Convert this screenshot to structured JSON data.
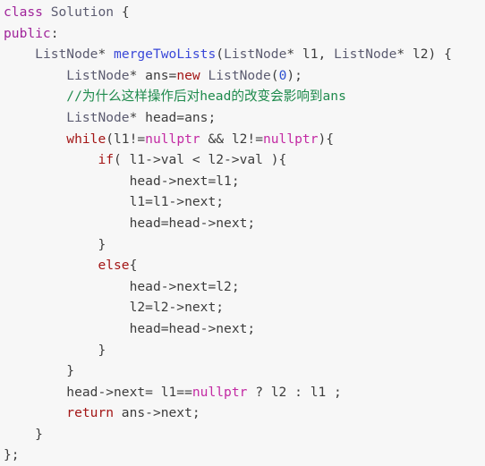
{
  "editor": {
    "language": "cpp",
    "background_color": "#f7f7f7",
    "default_text_color": "#3c3c3c",
    "palette": {
      "keyword_red": "#a31515",
      "keyword_purple": "#a0249a",
      "type_gray": "#5b5b70",
      "function_blue": "#3a48d8",
      "comment_green": "#1e8a4c",
      "number_blue": "#2c4fd0",
      "nullptr_magenta": "#c32aa3"
    }
  },
  "code": {
    "lines": [
      {
        "indent": 0,
        "tokens": [
          {
            "t": "class",
            "c": "kw2"
          },
          {
            "t": " ",
            "c": "plain"
          },
          {
            "t": "Solution",
            "c": "type"
          },
          {
            "t": " {",
            "c": "punct"
          }
        ]
      },
      {
        "indent": 0,
        "tokens": [
          {
            "t": "public",
            "c": "kw2"
          },
          {
            "t": ":",
            "c": "punct"
          }
        ]
      },
      {
        "indent": 1,
        "tokens": [
          {
            "t": "ListNode",
            "c": "type"
          },
          {
            "t": "* ",
            "c": "punct"
          },
          {
            "t": "mergeTwoLists",
            "c": "func"
          },
          {
            "t": "(",
            "c": "punct"
          },
          {
            "t": "ListNode",
            "c": "type"
          },
          {
            "t": "* l1, ",
            "c": "punct"
          },
          {
            "t": "ListNode",
            "c": "type"
          },
          {
            "t": "* l2) {",
            "c": "punct"
          }
        ]
      },
      {
        "indent": 2,
        "tokens": [
          {
            "t": "ListNode",
            "c": "type"
          },
          {
            "t": "* ans=",
            "c": "punct"
          },
          {
            "t": "new",
            "c": "keyword"
          },
          {
            "t": " ",
            "c": "plain"
          },
          {
            "t": "ListNode",
            "c": "type"
          },
          {
            "t": "(",
            "c": "punct"
          },
          {
            "t": "0",
            "c": "number"
          },
          {
            "t": ");",
            "c": "punct"
          }
        ]
      },
      {
        "indent": 2,
        "tokens": [
          {
            "t": "//为什么这样操作后对head的改变会影响到ans",
            "c": "comment"
          }
        ]
      },
      {
        "indent": 2,
        "tokens": [
          {
            "t": "ListNode",
            "c": "type"
          },
          {
            "t": "* head=ans;",
            "c": "punct"
          }
        ]
      },
      {
        "indent": 2,
        "tokens": [
          {
            "t": "while",
            "c": "keyword"
          },
          {
            "t": "(l1!=",
            "c": "punct"
          },
          {
            "t": "nullptr",
            "c": "null"
          },
          {
            "t": " && l2!=",
            "c": "punct"
          },
          {
            "t": "nullptr",
            "c": "null"
          },
          {
            "t": "){",
            "c": "punct"
          }
        ]
      },
      {
        "indent": 3,
        "tokens": [
          {
            "t": "if",
            "c": "keyword"
          },
          {
            "t": "( l1->val < l2->val ){",
            "c": "punct"
          }
        ]
      },
      {
        "indent": 4,
        "tokens": [
          {
            "t": "head->next=l1;",
            "c": "punct"
          }
        ]
      },
      {
        "indent": 4,
        "tokens": [
          {
            "t": "l1=l1->next;",
            "c": "punct"
          }
        ]
      },
      {
        "indent": 4,
        "tokens": [
          {
            "t": "head=head->next;",
            "c": "punct"
          }
        ]
      },
      {
        "indent": 3,
        "tokens": [
          {
            "t": "}",
            "c": "punct"
          }
        ]
      },
      {
        "indent": 3,
        "tokens": [
          {
            "t": "else",
            "c": "keyword"
          },
          {
            "t": "{",
            "c": "punct"
          }
        ]
      },
      {
        "indent": 4,
        "tokens": [
          {
            "t": "head->next=l2;",
            "c": "punct"
          }
        ]
      },
      {
        "indent": 4,
        "tokens": [
          {
            "t": "l2=l2->next;",
            "c": "punct"
          }
        ]
      },
      {
        "indent": 4,
        "tokens": [
          {
            "t": "head=head->next;",
            "c": "punct"
          }
        ]
      },
      {
        "indent": 3,
        "tokens": [
          {
            "t": "}",
            "c": "punct"
          }
        ]
      },
      {
        "indent": 2,
        "tokens": [
          {
            "t": "}",
            "c": "punct"
          }
        ]
      },
      {
        "indent": 2,
        "tokens": [
          {
            "t": "head->next= l1==",
            "c": "punct"
          },
          {
            "t": "nullptr",
            "c": "null"
          },
          {
            "t": " ? l2 : l1 ;",
            "c": "punct"
          }
        ]
      },
      {
        "indent": 2,
        "tokens": [
          {
            "t": "return",
            "c": "keyword"
          },
          {
            "t": " ans->next;",
            "c": "punct"
          }
        ]
      },
      {
        "indent": 1,
        "tokens": [
          {
            "t": "}",
            "c": "punct"
          }
        ]
      },
      {
        "indent": 0,
        "tokens": [
          {
            "t": "};",
            "c": "punct"
          }
        ]
      }
    ]
  }
}
